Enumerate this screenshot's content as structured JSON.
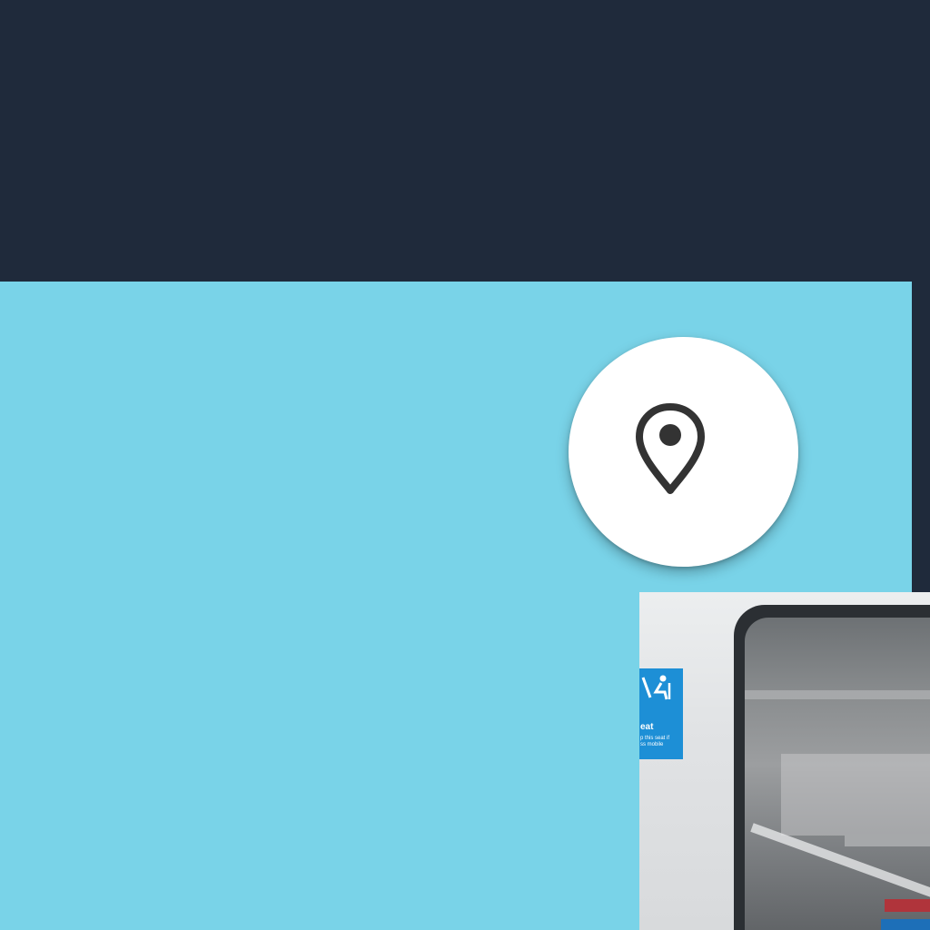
{
  "header": {},
  "map": {
    "background_color": "#79d3e8",
    "locate_button": {
      "icon": "map-pin-icon"
    }
  },
  "photo": {
    "sign_title": "eat",
    "sign_text": "p this seat if\nss mobile"
  },
  "colors": {
    "dark_background": "#1f2a3b",
    "map_panel": "#79d3e8",
    "button_background": "#ffffff",
    "icon_color": "#333333",
    "sign_blue": "#1d8fd6"
  }
}
